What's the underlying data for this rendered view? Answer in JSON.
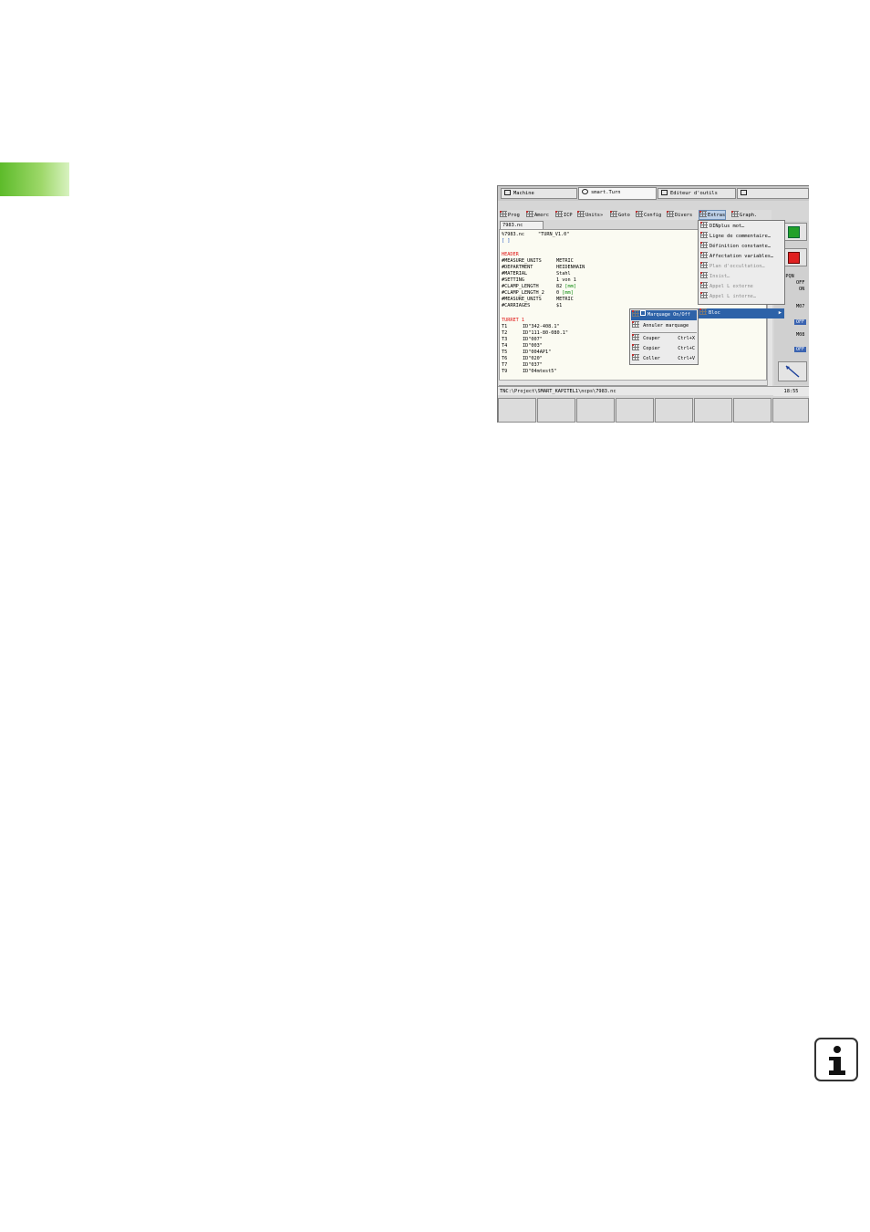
{
  "top_tabs": [
    {
      "label": "Machine"
    },
    {
      "label": "smart.Turn"
    },
    {
      "label": "Editeur d'outils"
    }
  ],
  "menu": [
    {
      "label": "Prog"
    },
    {
      "label": "Amorc"
    },
    {
      "label": "ICP"
    },
    {
      "label": "Units»"
    },
    {
      "label": "Goto"
    },
    {
      "label": "Config"
    },
    {
      "label": "Divers"
    },
    {
      "label": "Extras"
    },
    {
      "label": "Graph."
    }
  ],
  "file_tab": "7983.nc",
  "editor": {
    "lines": [
      {
        "key": "%7983.nc",
        "value": "\"TURN_V1.0\""
      },
      {
        "key": "[ ]",
        "value": ""
      },
      {
        "key": "HEADER",
        "value": ""
      },
      {
        "key": "#MEASURE_UNITS",
        "value": "METRIC"
      },
      {
        "key": "#DEPARTMENT",
        "value": "HEIDENHAIN"
      },
      {
        "key": "#MATERIAL",
        "value": "Stahl"
      },
      {
        "key": "#SETTING",
        "value": "1 von 1"
      },
      {
        "key": "#CLAMP_LENGTH",
        "value": "82",
        "unit": "[mm]"
      },
      {
        "key": "#CLAMP_LENGTH_2",
        "value": "0",
        "unit": "[mm]"
      },
      {
        "key": "#MEASURE_UNITS",
        "value": "METRIC"
      },
      {
        "key": "#CARRIAGES",
        "value": "$1"
      },
      {
        "key": "TURRET 1",
        "value": ""
      },
      {
        "key": "T1",
        "value": "ID\"342-408.1\""
      },
      {
        "key": "T2",
        "value": "ID\"111-80-080.1\""
      },
      {
        "key": "T3",
        "value": "ID\"007\""
      },
      {
        "key": "T4",
        "value": "ID\"003\""
      },
      {
        "key": "T5",
        "value": "ID\"004AP1\""
      },
      {
        "key": "T6",
        "value": "ID\"020\""
      },
      {
        "key": "T7",
        "value": "ID\"037\""
      },
      {
        "key": "T9",
        "value": "ID\"04mtest5\""
      }
    ]
  },
  "status_path": "TNC:\\Project\\SMART_KAPITEL1\\ncps\\7983.nc",
  "clock": "18:55",
  "extras_menu": [
    {
      "label": "DINplus mot…",
      "enabled": true
    },
    {
      "label": "Ligne de commentaire…",
      "enabled": true
    },
    {
      "label": "Définition constante…",
      "enabled": true
    },
    {
      "label": "Affectation variables…",
      "enabled": true
    },
    {
      "label": "Plan d'occultation…",
      "enabled": false
    },
    {
      "label": "Insist…",
      "enabled": false
    },
    {
      "label": "Appel L externe",
      "enabled": false
    },
    {
      "label": "Appel L interne…",
      "enabled": false
    },
    {
      "label": "Bloc",
      "enabled": true
    }
  ],
  "bloc_submenu": [
    {
      "label": "Marquage On/Off",
      "shortcut": ""
    },
    {
      "label": "Annuler marquage",
      "shortcut": ""
    },
    {
      "label": "Couper",
      "shortcut": "Ctrl+X"
    },
    {
      "label": "Copier",
      "shortcut": "Ctrl+C"
    },
    {
      "label": "Coller",
      "shortcut": "Ctrl+V"
    }
  ],
  "side_panel": {
    "feed_label": "ND PQN",
    "off_label": "OFF",
    "on_label": "ON",
    "m07": "M07",
    "m08": "M08",
    "off_badge": "OFF"
  },
  "info_icon": "info-icon"
}
